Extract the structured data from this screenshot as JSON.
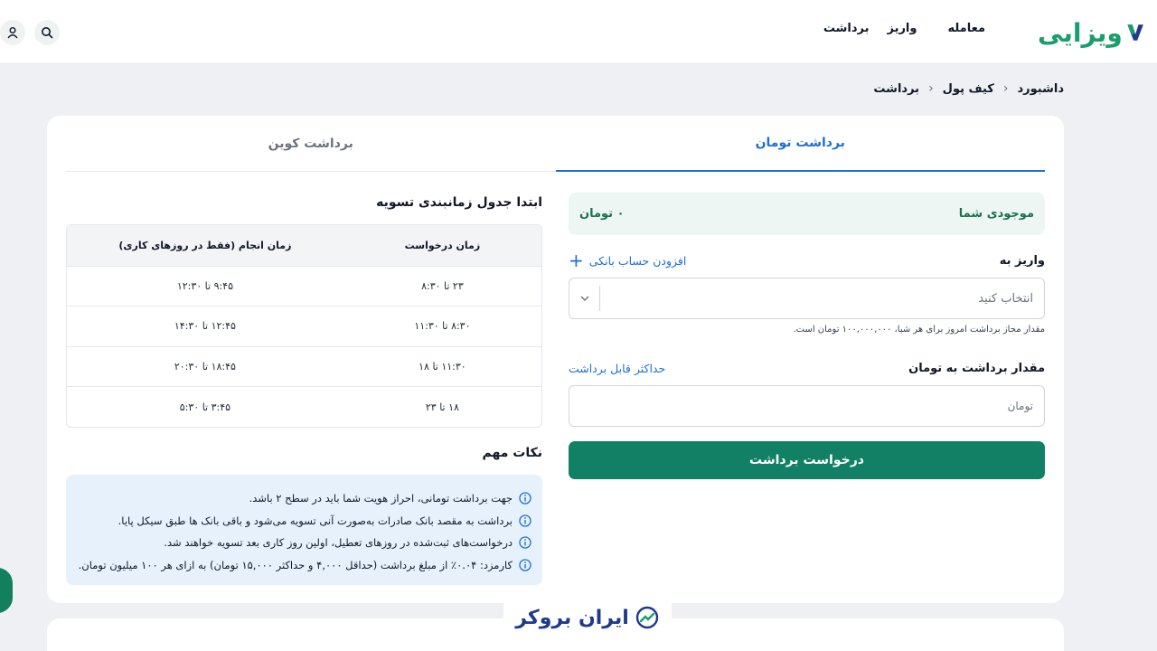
{
  "header": {
    "logo_text": "ویزایی",
    "nav": [
      "معامله",
      "واریز",
      "برداشت"
    ]
  },
  "breadcrumb": [
    "داشبورد",
    "کیف پول",
    "برداشت"
  ],
  "tabs": [
    "برداشت تومان",
    "برداشت کوین"
  ],
  "balance": {
    "label": "موجودی شما",
    "value": "۰ تومان"
  },
  "deposit": {
    "label": "واریز به",
    "add_account": "افزودن حساب بانکی",
    "placeholder": "انتخاب کنید",
    "hint": "مقدار مجاز برداشت امروز برای هر شبا، ۱۰۰,۰۰۰,۰۰۰ تومان است."
  },
  "amount": {
    "label": "مقدار برداشت به تومان",
    "max_link": "حداکثر قابل برداشت",
    "placeholder": "تومان"
  },
  "submit_label": "درخواست برداشت",
  "schedule": {
    "title": "ابتدا جدول زمانبندی تسویه",
    "headers": [
      "زمان درخواست",
      "زمان انجام (فقط در روزهای کاری)"
    ],
    "rows": [
      [
        "۲۳ تا ۸:۳۰",
        "۹:۴۵ تا ۱۲:۳۰"
      ],
      [
        "۸:۳۰ تا ۱۱:۳۰",
        "۱۲:۴۵ تا ۱۴:۳۰"
      ],
      [
        "۱۱:۳۰ تا ۱۸",
        "۱۸:۴۵ تا ۲۰:۳۰"
      ],
      [
        "۱۸ تا ۲۳",
        "۳:۴۵ تا ۵:۳۰"
      ]
    ]
  },
  "notes": {
    "title": "نکات مهم",
    "items": [
      "جهت برداشت تومانی، احراز هویت شما باید در سطح ۲ باشد.",
      "برداشت به مقصد بانک صادرات به‌صورت آنی تسویه می‌شود و باقی بانک ها طبق سیکل پایا.",
      "درخواست‌های ثبت‌شده در روزهای تعطیل، اولین روز کاری بعد تسویه خواهند شد.",
      "کارمزد: ۰.۰۴٪ از مبلغ برداشت (حداقل ۴,۰۰۰ و حداکثر ۱۵,۰۰۰ تومان) به ازای هر ۱۰۰ میلیون تومان."
    ]
  },
  "watermark": "ایران بروکر",
  "colors": {
    "accent": "#1d6fd8",
    "primary": "#128064",
    "balance_bg": "#eef6f3",
    "notes_bg": "#e6f1fc"
  }
}
